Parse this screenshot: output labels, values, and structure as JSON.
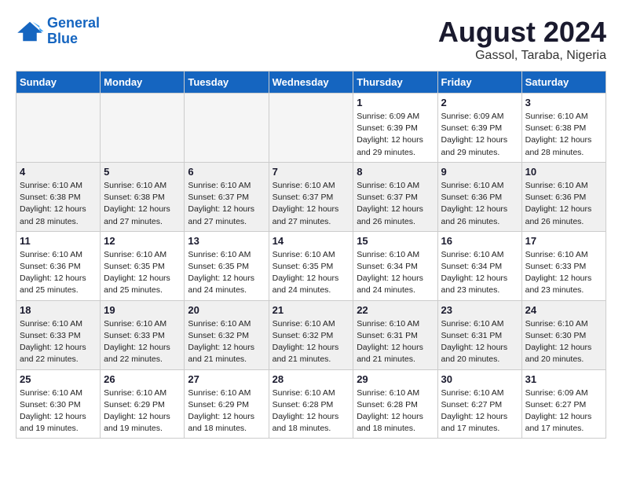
{
  "logo": {
    "line1": "General",
    "line2": "Blue"
  },
  "title": "August 2024",
  "location": "Gassol, Taraba, Nigeria",
  "weekdays": [
    "Sunday",
    "Monday",
    "Tuesday",
    "Wednesday",
    "Thursday",
    "Friday",
    "Saturday"
  ],
  "weeks": [
    [
      {
        "day": "",
        "info": ""
      },
      {
        "day": "",
        "info": ""
      },
      {
        "day": "",
        "info": ""
      },
      {
        "day": "",
        "info": ""
      },
      {
        "day": "1",
        "info": "Sunrise: 6:09 AM\nSunset: 6:39 PM\nDaylight: 12 hours\nand 29 minutes."
      },
      {
        "day": "2",
        "info": "Sunrise: 6:09 AM\nSunset: 6:39 PM\nDaylight: 12 hours\nand 29 minutes."
      },
      {
        "day": "3",
        "info": "Sunrise: 6:10 AM\nSunset: 6:38 PM\nDaylight: 12 hours\nand 28 minutes."
      }
    ],
    [
      {
        "day": "4",
        "info": "Sunrise: 6:10 AM\nSunset: 6:38 PM\nDaylight: 12 hours\nand 28 minutes."
      },
      {
        "day": "5",
        "info": "Sunrise: 6:10 AM\nSunset: 6:38 PM\nDaylight: 12 hours\nand 27 minutes."
      },
      {
        "day": "6",
        "info": "Sunrise: 6:10 AM\nSunset: 6:37 PM\nDaylight: 12 hours\nand 27 minutes."
      },
      {
        "day": "7",
        "info": "Sunrise: 6:10 AM\nSunset: 6:37 PM\nDaylight: 12 hours\nand 27 minutes."
      },
      {
        "day": "8",
        "info": "Sunrise: 6:10 AM\nSunset: 6:37 PM\nDaylight: 12 hours\nand 26 minutes."
      },
      {
        "day": "9",
        "info": "Sunrise: 6:10 AM\nSunset: 6:36 PM\nDaylight: 12 hours\nand 26 minutes."
      },
      {
        "day": "10",
        "info": "Sunrise: 6:10 AM\nSunset: 6:36 PM\nDaylight: 12 hours\nand 26 minutes."
      }
    ],
    [
      {
        "day": "11",
        "info": "Sunrise: 6:10 AM\nSunset: 6:36 PM\nDaylight: 12 hours\nand 25 minutes."
      },
      {
        "day": "12",
        "info": "Sunrise: 6:10 AM\nSunset: 6:35 PM\nDaylight: 12 hours\nand 25 minutes."
      },
      {
        "day": "13",
        "info": "Sunrise: 6:10 AM\nSunset: 6:35 PM\nDaylight: 12 hours\nand 24 minutes."
      },
      {
        "day": "14",
        "info": "Sunrise: 6:10 AM\nSunset: 6:35 PM\nDaylight: 12 hours\nand 24 minutes."
      },
      {
        "day": "15",
        "info": "Sunrise: 6:10 AM\nSunset: 6:34 PM\nDaylight: 12 hours\nand 24 minutes."
      },
      {
        "day": "16",
        "info": "Sunrise: 6:10 AM\nSunset: 6:34 PM\nDaylight: 12 hours\nand 23 minutes."
      },
      {
        "day": "17",
        "info": "Sunrise: 6:10 AM\nSunset: 6:33 PM\nDaylight: 12 hours\nand 23 minutes."
      }
    ],
    [
      {
        "day": "18",
        "info": "Sunrise: 6:10 AM\nSunset: 6:33 PM\nDaylight: 12 hours\nand 22 minutes."
      },
      {
        "day": "19",
        "info": "Sunrise: 6:10 AM\nSunset: 6:33 PM\nDaylight: 12 hours\nand 22 minutes."
      },
      {
        "day": "20",
        "info": "Sunrise: 6:10 AM\nSunset: 6:32 PM\nDaylight: 12 hours\nand 21 minutes."
      },
      {
        "day": "21",
        "info": "Sunrise: 6:10 AM\nSunset: 6:32 PM\nDaylight: 12 hours\nand 21 minutes."
      },
      {
        "day": "22",
        "info": "Sunrise: 6:10 AM\nSunset: 6:31 PM\nDaylight: 12 hours\nand 21 minutes."
      },
      {
        "day": "23",
        "info": "Sunrise: 6:10 AM\nSunset: 6:31 PM\nDaylight: 12 hours\nand 20 minutes."
      },
      {
        "day": "24",
        "info": "Sunrise: 6:10 AM\nSunset: 6:30 PM\nDaylight: 12 hours\nand 20 minutes."
      }
    ],
    [
      {
        "day": "25",
        "info": "Sunrise: 6:10 AM\nSunset: 6:30 PM\nDaylight: 12 hours\nand 19 minutes."
      },
      {
        "day": "26",
        "info": "Sunrise: 6:10 AM\nSunset: 6:29 PM\nDaylight: 12 hours\nand 19 minutes."
      },
      {
        "day": "27",
        "info": "Sunrise: 6:10 AM\nSunset: 6:29 PM\nDaylight: 12 hours\nand 18 minutes."
      },
      {
        "day": "28",
        "info": "Sunrise: 6:10 AM\nSunset: 6:28 PM\nDaylight: 12 hours\nand 18 minutes."
      },
      {
        "day": "29",
        "info": "Sunrise: 6:10 AM\nSunset: 6:28 PM\nDaylight: 12 hours\nand 18 minutes."
      },
      {
        "day": "30",
        "info": "Sunrise: 6:10 AM\nSunset: 6:27 PM\nDaylight: 12 hours\nand 17 minutes."
      },
      {
        "day": "31",
        "info": "Sunrise: 6:09 AM\nSunset: 6:27 PM\nDaylight: 12 hours\nand 17 minutes."
      }
    ]
  ]
}
